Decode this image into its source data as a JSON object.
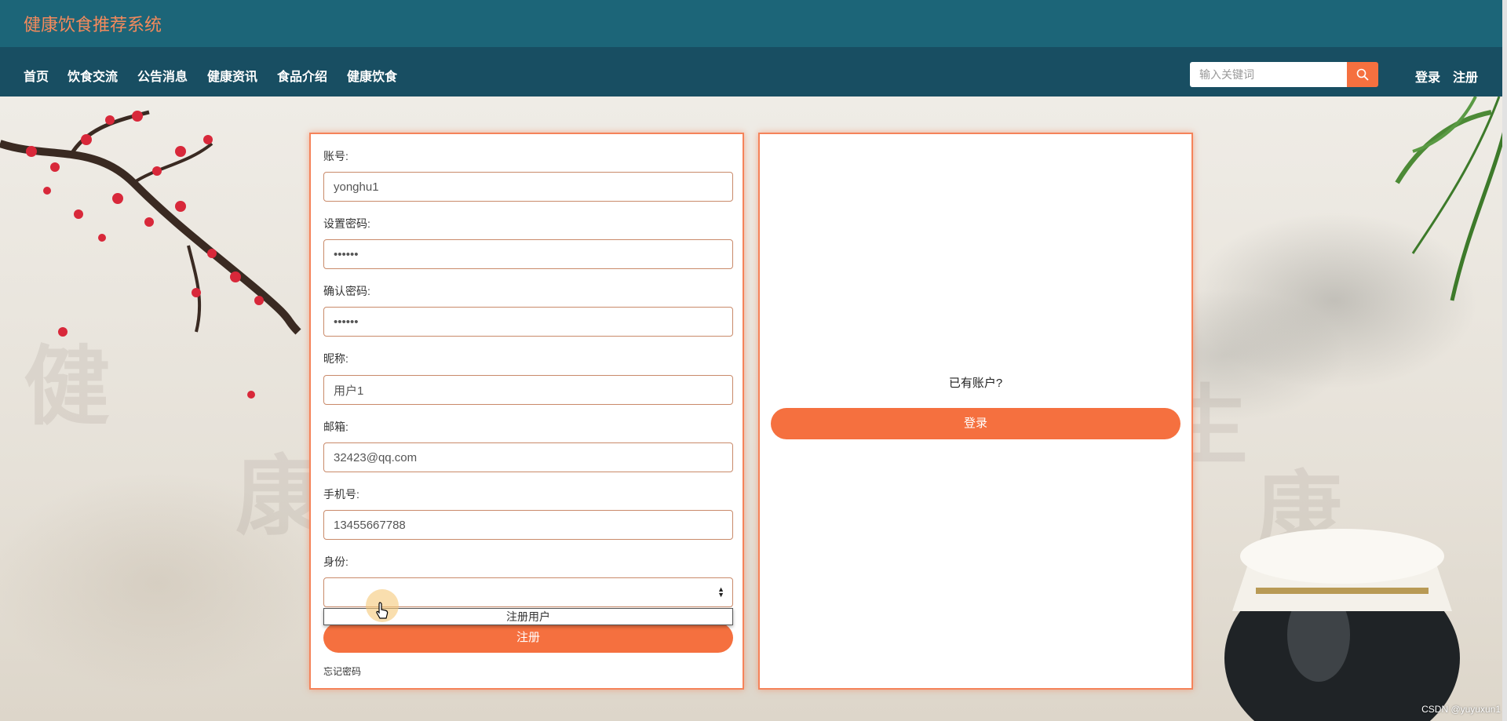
{
  "site": {
    "title": "健康饮食推荐系统"
  },
  "nav": {
    "items": [
      {
        "label": "首页"
      },
      {
        "label": "饮食交流"
      },
      {
        "label": "公告消息"
      },
      {
        "label": "健康资讯"
      },
      {
        "label": "食品介绍"
      },
      {
        "label": "健康饮食"
      }
    ]
  },
  "search": {
    "placeholder": "输入关键词",
    "value": ""
  },
  "top_links": {
    "login": "登录",
    "register": "注册"
  },
  "register_form": {
    "account": {
      "label": "账号:",
      "value": "yonghu1"
    },
    "password": {
      "label": "设置密码:",
      "value": "123456"
    },
    "confirm_password": {
      "label": "确认密码:",
      "value": "123456"
    },
    "nickname": {
      "label": "昵称:",
      "value": "用户1"
    },
    "email": {
      "label": "邮箱:",
      "value": "32423@qq.com"
    },
    "phone": {
      "label": "手机号:",
      "value": "13455667788"
    },
    "role": {
      "label": "身份:",
      "selected": "",
      "options": [
        "注册用户"
      ]
    },
    "submit_label": "注册",
    "forgot_label": "忘记密码"
  },
  "login_panel": {
    "prompt": "已有账户?",
    "login_label": "登录"
  },
  "watermark": "CSDN @yuyuxun1",
  "colors": {
    "accent": "#f5703f",
    "topbar": "#1c6578",
    "navbar": "#184e62",
    "title": "#f48a5c"
  }
}
